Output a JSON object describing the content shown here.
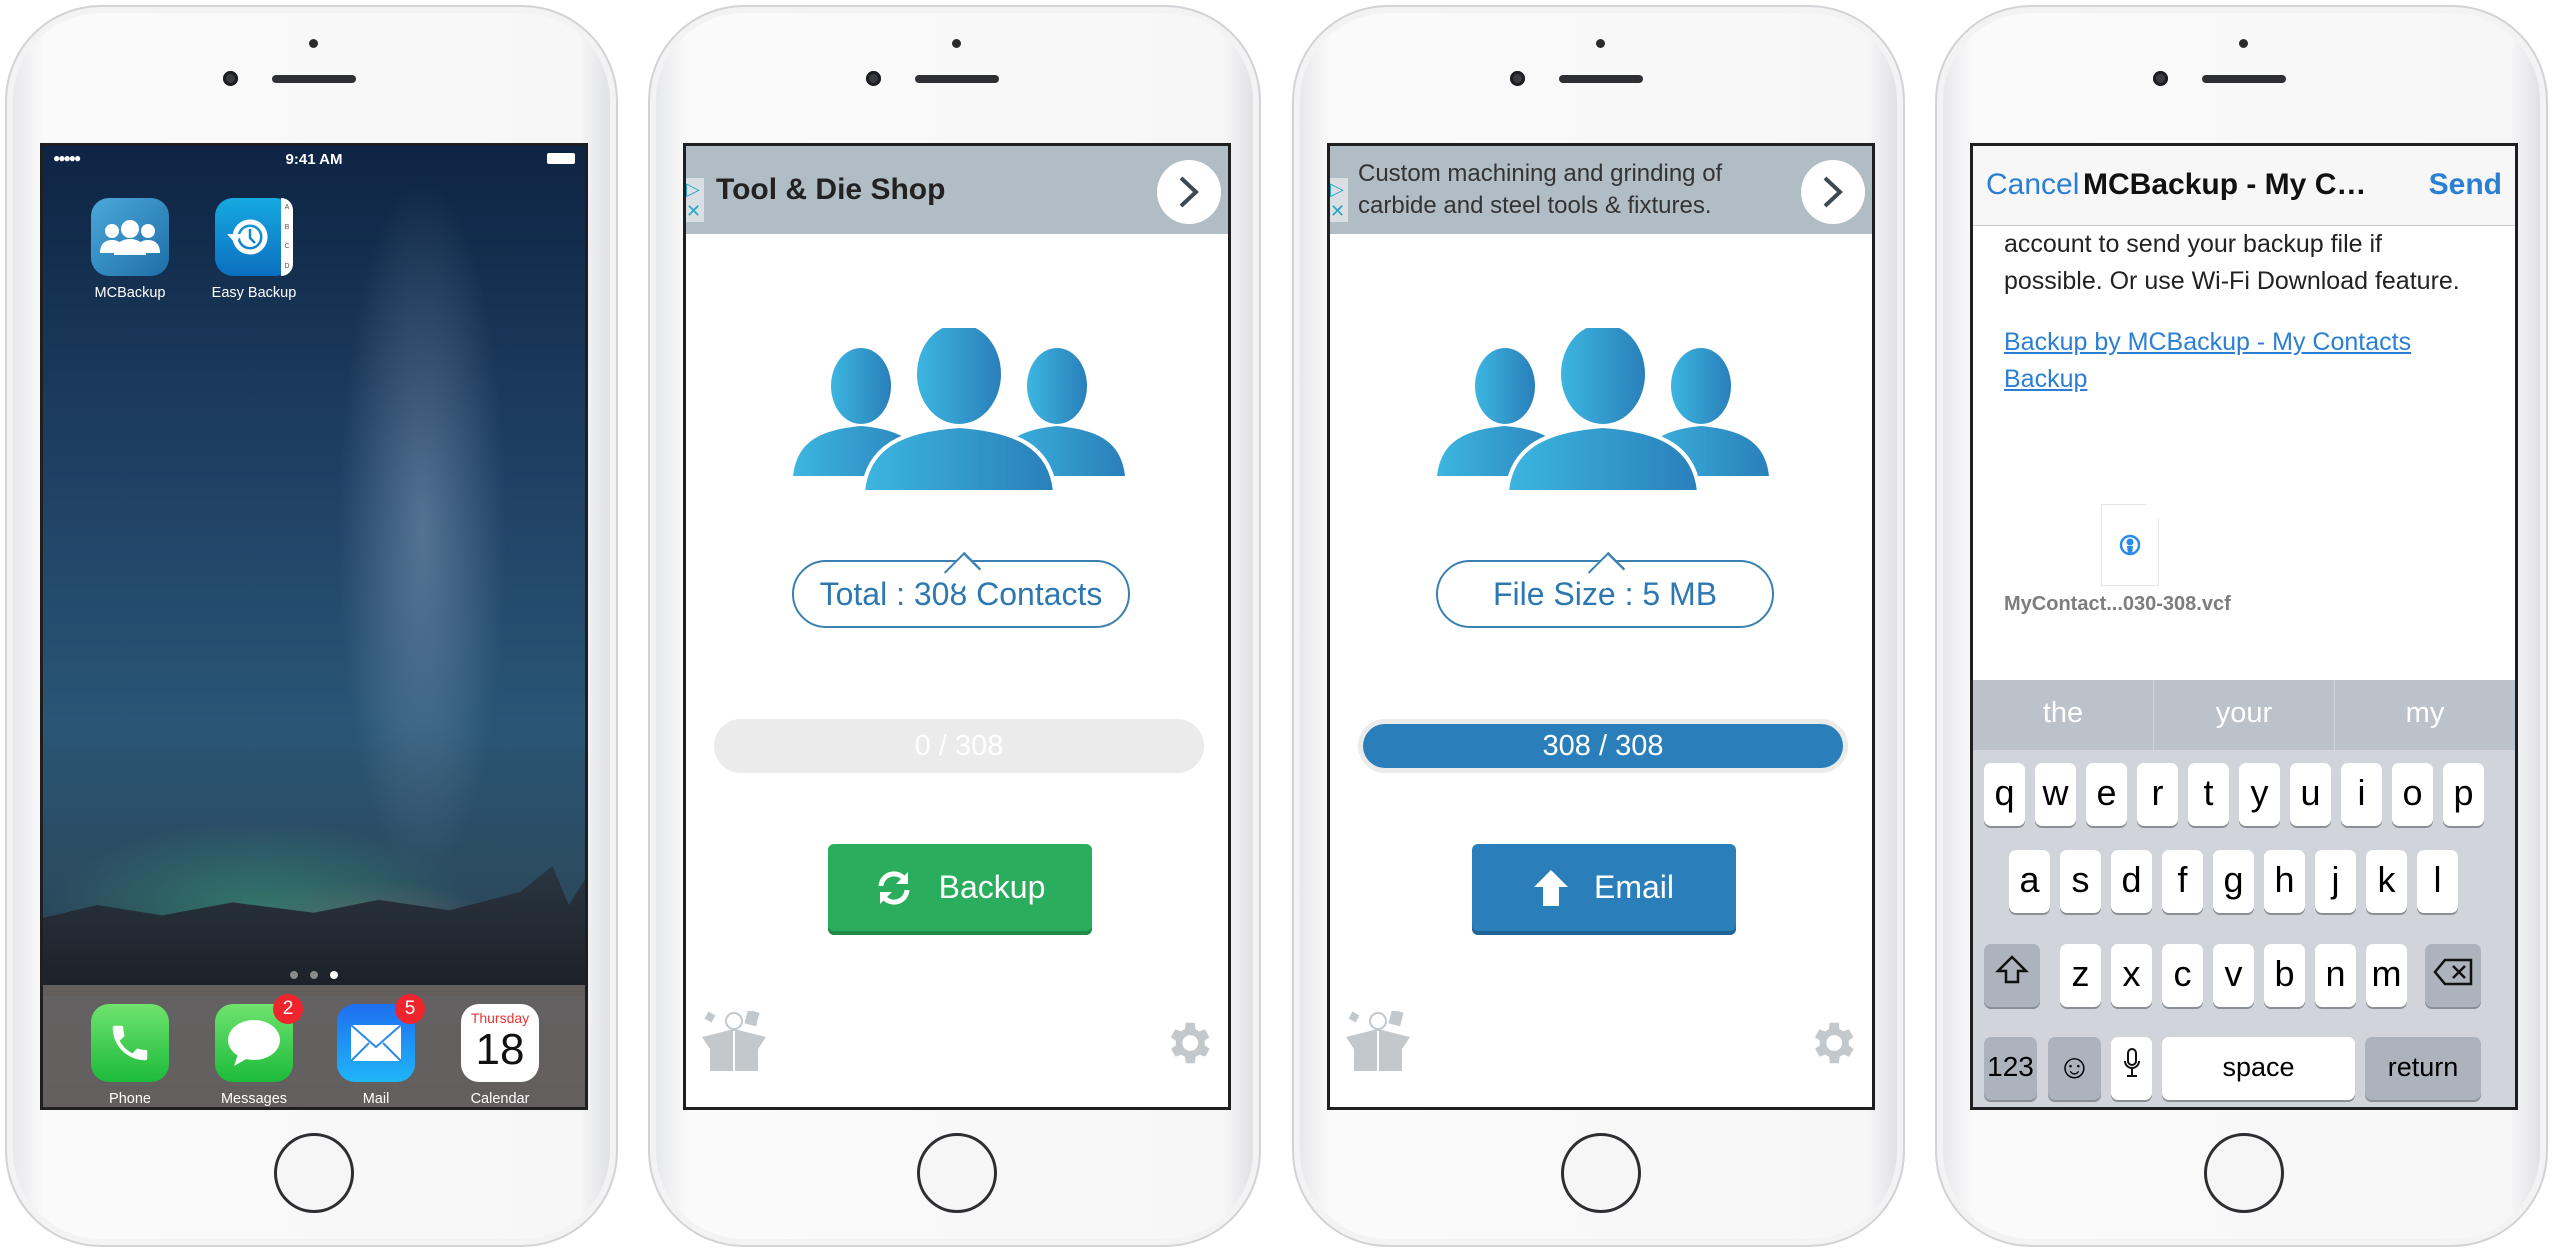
{
  "home": {
    "status": {
      "signal": "●●●●●",
      "time": "9:41 AM"
    },
    "apps": [
      {
        "label": "MCBackup",
        "icon": "mcbackup-app-icon"
      },
      {
        "label": "Easy Backup",
        "icon": "easy-backup-app-icon",
        "tabs": [
          "A",
          "B",
          "C",
          "D"
        ]
      }
    ],
    "page_dots": 3,
    "active_page": 3,
    "dock": [
      {
        "label": "Phone",
        "icon": "phone-icon"
      },
      {
        "label": "Messages",
        "icon": "messages-icon",
        "badge": "2"
      },
      {
        "label": "Mail",
        "icon": "mail-icon",
        "badge": "5"
      },
      {
        "label": "Calendar",
        "icon": "calendar-icon",
        "day": "Thursday",
        "date": "18"
      }
    ]
  },
  "backup_screen": {
    "ad": {
      "text": "Tool & Die Shop"
    },
    "total_label": "Total : 308 Contacts",
    "progress": {
      "text": "0 / 308",
      "value": 0,
      "total": 308
    },
    "button": "Backup",
    "color": "#2aad5c"
  },
  "email_screen": {
    "ad": {
      "line1": "Custom machining and grinding of",
      "line2": "carbide and steel tools & fixtures."
    },
    "size_label": "File Size : 5 MB",
    "progress": {
      "text": "308 / 308",
      "value": 308,
      "total": 308
    },
    "button": "Email",
    "color": "#2a7fba"
  },
  "mail": {
    "cancel": "Cancel",
    "title": "MCBackup - My Contacts Backup",
    "send": "Send",
    "body_line1": "account to send your backup file if",
    "body_line2": "possible. Or use Wi-Fi Download feature.",
    "link": "Backup by MCBackup - My Contacts Backup",
    "attachment": "MyContact...030-308.vcf",
    "keyboard": {
      "suggestions": [
        "the",
        "your",
        "my"
      ],
      "rows": [
        [
          "q",
          "w",
          "e",
          "r",
          "t",
          "y",
          "u",
          "i",
          "o",
          "p"
        ],
        [
          "a",
          "s",
          "d",
          "f",
          "g",
          "h",
          "j",
          "k",
          "l"
        ],
        [
          "z",
          "x",
          "c",
          "v",
          "b",
          "n",
          "m"
        ]
      ],
      "numbers": "123",
      "space": "space",
      "return": "return"
    }
  }
}
